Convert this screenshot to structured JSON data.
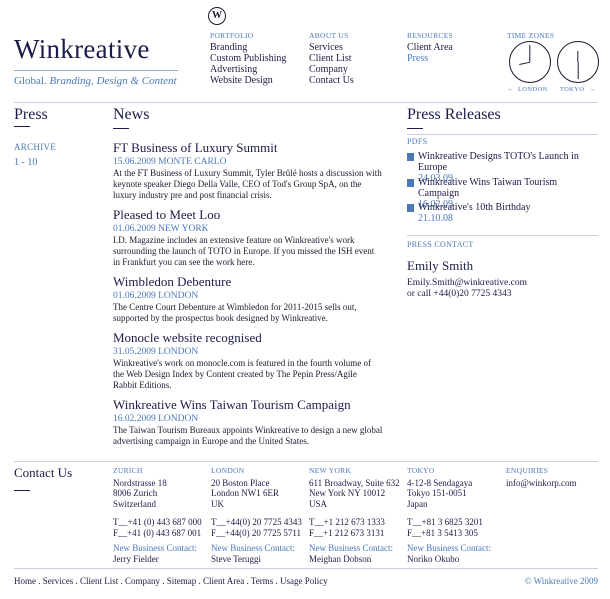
{
  "header": {
    "logo_letter": "W",
    "brand": "Winkreative",
    "tagline_plain": "Global.",
    "tagline_italic": "Branding, Design & Content"
  },
  "nav": {
    "portfolio": {
      "heading": "PORTFOLIO",
      "items": [
        "Branding",
        "Custom Publishing",
        "Advertising",
        "Website Design"
      ]
    },
    "about": {
      "heading": "ABOUT US",
      "items": [
        "Services",
        "Client List",
        "Company",
        "Contact Us"
      ]
    },
    "resources": {
      "heading": "RESOURCES",
      "items": [
        "Client Area",
        "Press"
      ]
    },
    "timezones": {
      "heading": "TIME ZONES",
      "left_arrow": "←",
      "london": "LONDON",
      "tokyo": "TOKYO",
      "right_arrow": "→"
    }
  },
  "press": {
    "title": "Press",
    "archive_label": "ARCHIVE",
    "archive_range": "1 - 10"
  },
  "news": {
    "title": "News",
    "items": [
      {
        "title": "FT Business of Luxury Summit",
        "date": "15.06.2009 MONTE CARLO",
        "body": "At the FT Business of Luxury Summit, Tyler Brûlé hosts a discussion with keynote speaker Diego Della Valle, CEO of Tod's Group SpA, on the luxury industry pre and post financial crisis."
      },
      {
        "title": "Pleased to Meet Loo",
        "date": "01.06.2009 NEW YORK",
        "body": "I.D. Magazine includes an extensive feature on Winkreative's work surrounding the launch of TOTO in Europe. If you missed the ISH event in Frankfurt you can see the work here."
      },
      {
        "title": "Wimbledon Debenture",
        "date": "01.06.2009 LONDON",
        "body": "The Centre Court Debenture at Wimbledon for 2011-2015 sells out, supported by the prospectus book designed by Winkreative."
      },
      {
        "title": "Monocle website recognised",
        "date": "31.05.2009 LONDON",
        "body": "Winkreative's work on monocle.com is featured in the fourth volume of the Web Design Index by Content created by The Pepin Press/Agile Rabbit Editions."
      },
      {
        "title": "Winkreative Wins Taiwan Tourism Campaign",
        "date": "16.02.2009 LONDON",
        "body": "The Taiwan Tourism Bureaux appoints Winkreative to design a new global advertising campaign in Europe and the United States."
      }
    ]
  },
  "press_releases": {
    "title": "Press Releases",
    "pdfs_label": "PDFS",
    "items": [
      {
        "title": "Winkreative Designs TOTO's Launch in Europe",
        "date": "24.03.09"
      },
      {
        "title": "Winkreative Wins Taiwan Tourism Campaign",
        "date": "16.02.09"
      },
      {
        "title": "Winkreative's 10th Birthday",
        "date": "21.10.08"
      }
    ],
    "contact_label": "PRESS CONTACT",
    "contact_name": "Emily Smith",
    "contact_email": "Emily.Smith@winkreative.com",
    "contact_phone": "or call +44(0)20 7725 4343"
  },
  "contact": {
    "title": "Contact Us",
    "offices": [
      {
        "city": "ZURICH",
        "lines": [
          "Nordstrasse 18",
          "8006 Zurich",
          "Switzerland",
          ""
        ],
        "tel": "T__+41 (0) 443 687 000",
        "fax": "F__+41 (0) 443 687 001",
        "nbc_label": "New Business Contact:",
        "nbc_name": "Jerry Fielder"
      },
      {
        "city": "LONDON",
        "lines": [
          "20 Boston Place",
          "London NW1 6ER",
          "UK",
          ""
        ],
        "tel": "T__+44(0) 20 7725 4343",
        "fax": "F__+44(0) 20 7725 5711",
        "nbc_label": "New Business Contact:",
        "nbc_name": "Steve Teruggi"
      },
      {
        "city": "NEW YORK",
        "lines": [
          "611 Broadway, Suite 632",
          "New York NY 10012",
          "USA",
          ""
        ],
        "tel": "T__+1 212 673 1333",
        "fax": "F__+1 212 673 3131",
        "nbc_label": "New Business Contact:",
        "nbc_name": "Meighan Dobson"
      },
      {
        "city": "TOKYO",
        "lines": [
          "4-12-8 Sendagaya",
          "Tokyo 151-0051",
          "Japan",
          ""
        ],
        "tel": "T__+81 3 6825 3201",
        "fax": "F__+81 3 5413 305",
        "nbc_label": "New Business Contact:",
        "nbc_name": "Noriko Okubo"
      }
    ],
    "enquiries_label": "ENQUIRIES",
    "enquiries_email": "info@winkorp.com"
  },
  "footer": {
    "links": [
      "Home",
      "Services",
      "Client List",
      "Company",
      "Sitemap",
      "Client Area",
      "Terms",
      "Usage Policy"
    ],
    "copyright": "© Winkreative 2009"
  }
}
